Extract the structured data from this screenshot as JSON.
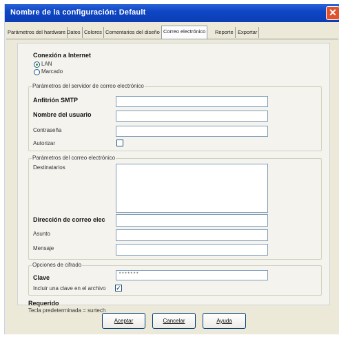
{
  "window": {
    "title": "Nombre de la configuración: Default",
    "close_symbol": "✕"
  },
  "tabs": [
    {
      "label": "Parámetros del hardware"
    },
    {
      "label": "Datos"
    },
    {
      "label": "Colores"
    },
    {
      "label": "Comentarios del diseño"
    },
    {
      "label": "Correo electrónico"
    },
    {
      "label": "Reporte"
    },
    {
      "label": "Exportar"
    }
  ],
  "connection": {
    "heading": "Conexión a Internet",
    "options": [
      {
        "label": "LAN",
        "selected": true
      },
      {
        "label": "Marcado",
        "selected": false
      }
    ]
  },
  "server": {
    "group_title": "Parámetros del servidor de correo electrónico",
    "smtp_host": {
      "label": "Anfitrión SMTP",
      "value": ""
    },
    "username": {
      "label": "Nombre del usuario",
      "value": ""
    },
    "password": {
      "label": "Contraseña",
      "value": ""
    },
    "authorize": {
      "label": "Autorizar",
      "checked": false
    }
  },
  "mail": {
    "group_title": "Parámetros del correo electrónico",
    "recipients": {
      "label": "Destinatarios",
      "value": ""
    },
    "from_address": {
      "label": "Dirección de correo elec",
      "value": ""
    },
    "subject": {
      "label": "Asunto",
      "value": ""
    },
    "message": {
      "label": "Mensaje",
      "value": ""
    }
  },
  "encryption": {
    "group_title": "Opciones de cifrado",
    "key": {
      "label": "Clave",
      "value": "*******"
    },
    "include_key": {
      "label": "Incluir una clave en el archivo",
      "checked": true,
      "mark": "✓"
    }
  },
  "required": {
    "heading": "Requerido",
    "note": "Tecla predeterminada = surtech"
  },
  "buttons": {
    "accept": "Aceptar",
    "cancel": "Cancelar",
    "help": "Ayuda"
  }
}
